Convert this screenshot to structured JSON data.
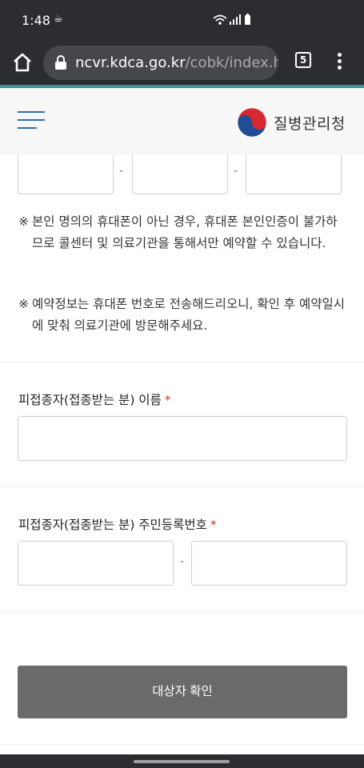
{
  "status_bar": {
    "time": "1:48",
    "icons": [
      "coffee-icon",
      "wifi-icon",
      "signal-icon",
      "battery-icon"
    ]
  },
  "browser": {
    "url_host": "ncvr.kdca.go.kr",
    "url_path": "/cobk/index.h",
    "tab_count": "5"
  },
  "header": {
    "org_name": "질병관리청",
    "colors": {
      "menu": "#2f6fa8",
      "logo_red": "#d7282f",
      "logo_blue": "#1f4e96"
    }
  },
  "phone_fields": {
    "separator": "-"
  },
  "notices": [
    {
      "mark": "※",
      "text": "본인 명의의 휴대폰이 아닌 경우, 휴대폰 본인인증이 불가하므로 콜센터 및 의료기관을 통해서만 예약할 수 있습니다."
    },
    {
      "mark": "※",
      "text": "예약정보는 휴대폰 번호로 전송해드리오니, 확인 후 예약일시에 맞춰 의료기관에 방문해주세요."
    }
  ],
  "form": {
    "name_label": "피접종자(접종받는 분) 이름",
    "rrn_label": "피접종자(접종받는 분) 주민등록번호",
    "required_mark": "*",
    "rrn_separator": "-"
  },
  "confirm_button": {
    "label": "대상자 확인"
  }
}
